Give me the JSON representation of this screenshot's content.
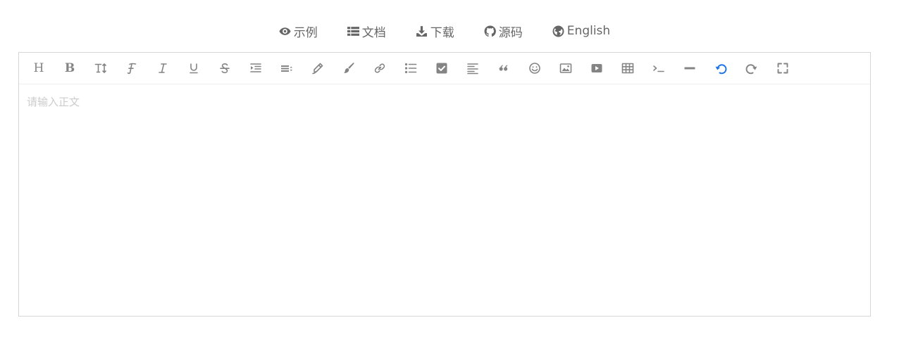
{
  "nav": {
    "items": [
      {
        "label": "示例",
        "icon": "eye-icon"
      },
      {
        "label": "文档",
        "icon": "list-icon"
      },
      {
        "label": "下载",
        "icon": "download-icon"
      },
      {
        "label": "源码",
        "icon": "github-icon"
      },
      {
        "label": "English",
        "icon": "globe-icon"
      }
    ]
  },
  "toolbar": {
    "buttons": [
      {
        "name": "title",
        "icon": "heading-icon"
      },
      {
        "name": "bold",
        "icon": "bold-icon"
      },
      {
        "name": "font-size",
        "icon": "text-height-icon"
      },
      {
        "name": "font-family",
        "icon": "font-family-icon"
      },
      {
        "name": "italic",
        "icon": "italic-icon"
      },
      {
        "name": "underline",
        "icon": "underline-icon"
      },
      {
        "name": "strikethrough",
        "icon": "strikethrough-icon"
      },
      {
        "name": "indent",
        "icon": "indent-icon"
      },
      {
        "name": "line-height",
        "icon": "line-height-icon"
      },
      {
        "name": "font-color",
        "icon": "pencil-icon"
      },
      {
        "name": "background-color",
        "icon": "brush-icon"
      },
      {
        "name": "link",
        "icon": "link-icon"
      },
      {
        "name": "list",
        "icon": "list-bullet-icon"
      },
      {
        "name": "todo",
        "icon": "checkbox-icon"
      },
      {
        "name": "justify",
        "icon": "align-left-icon"
      },
      {
        "name": "quote",
        "icon": "quote-icon"
      },
      {
        "name": "emoticon",
        "icon": "smile-icon"
      },
      {
        "name": "image",
        "icon": "image-icon"
      },
      {
        "name": "video",
        "icon": "video-icon"
      },
      {
        "name": "table",
        "icon": "table-icon"
      },
      {
        "name": "code",
        "icon": "terminal-icon"
      },
      {
        "name": "split-line",
        "icon": "horizontal-line-icon"
      },
      {
        "name": "undo",
        "icon": "undo-icon"
      },
      {
        "name": "redo",
        "icon": "redo-icon"
      },
      {
        "name": "fullscreen",
        "icon": "fullscreen-icon"
      }
    ],
    "active_color": "#1a73e8",
    "icon_color": "#848484"
  },
  "editor": {
    "placeholder": "请输入正文",
    "value": ""
  }
}
